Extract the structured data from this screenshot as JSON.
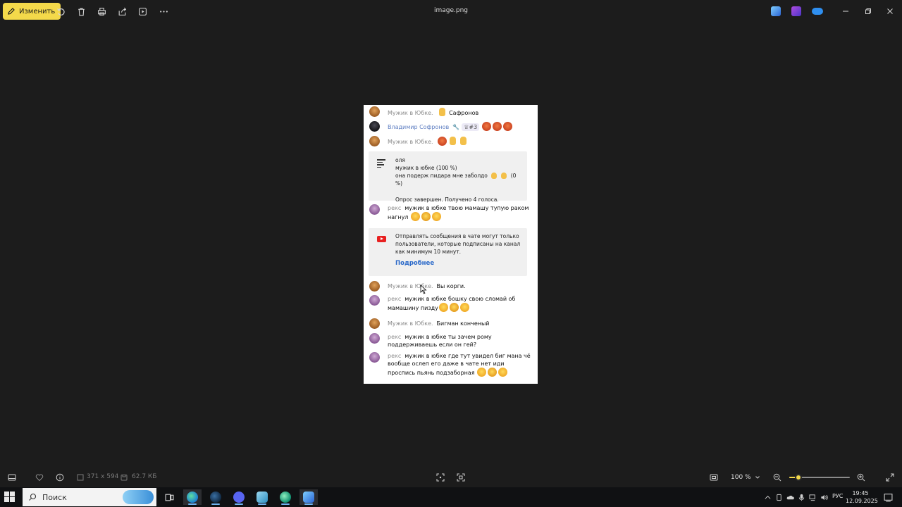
{
  "toolbar": {
    "edit_label": "Изменить",
    "title": "image.png"
  },
  "chat": {
    "messages": [
      {
        "author": "Мужик в Юбке.",
        "text": "Сафронов",
        "avatar": "orange"
      },
      {
        "author": "Владимир Софронов",
        "badge": "#3",
        "avatar": "dark"
      },
      {
        "author": "Мужик в Юбке.",
        "avatar": "orange"
      },
      {
        "author": "рекс",
        "text": "мужик в юбке твою мамашу тупую раком нагнул",
        "avatar": "purple"
      },
      {
        "author": "Мужик в Юбке.",
        "text": "Вы корги.",
        "avatar": "orange"
      },
      {
        "author": "рекс",
        "text": "мужик в юбке бошку свою сломай об мамашину пизду",
        "avatar": "purple"
      },
      {
        "author": "Мужик в Юбке.",
        "text": "Бигман конченый",
        "avatar": "orange"
      },
      {
        "author": "рекс",
        "text": "мужик в юбке ты зачем рому поддерживаешь если он гей?",
        "avatar": "purple"
      },
      {
        "author": "рекс",
        "text": "мужик в юбке где тут увидел биг мана чё вообще ослеп его даже в чате нет иди проспись пьянь подзаборная",
        "avatar": "purple"
      }
    ],
    "poll": {
      "title": "оля",
      "option1": "мужик в юбке (100 %)",
      "option2_text": "она подерж пидара мне заболдо",
      "option2_pct": "(0 %)",
      "status": "Опрос завершен. Получено 4 голоса."
    },
    "notice": {
      "text": "Отправлять сообщения в чате могут только пользователи, которые подписаны на канал как минимум 10 минут.",
      "link": "Подробнее"
    }
  },
  "statusbar": {
    "dimensions": "371 x 594",
    "filesize": "62.7 КБ",
    "zoom": "100 %",
    "zoom_level": 0.15
  },
  "taskbar": {
    "search_placeholder": "Поиск",
    "language": "РУС",
    "time": "19:45",
    "date": "12.09.2025"
  },
  "colors": {
    "accent": "#f4d94a",
    "background": "#1c1c1c",
    "link": "#2a69c9"
  }
}
